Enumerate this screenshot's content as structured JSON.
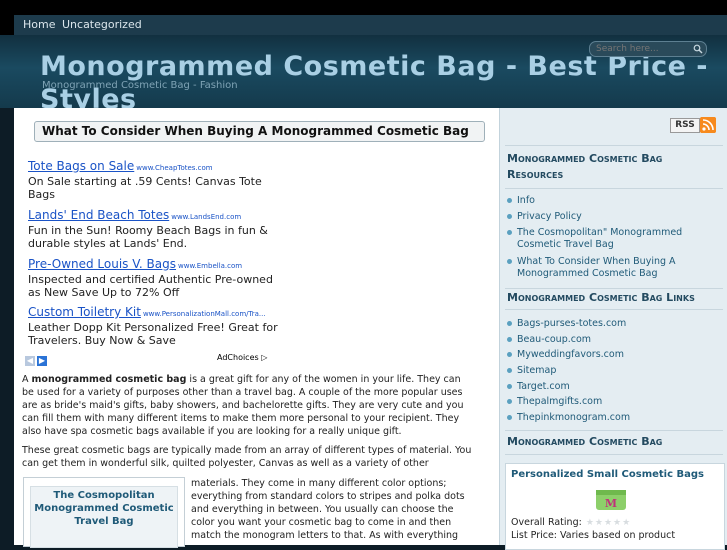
{
  "nav": {
    "items": [
      "Home",
      "Uncategorized"
    ]
  },
  "header": {
    "title_line1": "Monogrammed Cosmetic Bag - Best Price -",
    "title_line2": "Styles",
    "description": "Monogrammed Cosmetic Bag - Fashion"
  },
  "search": {
    "placeholder": "Search here..."
  },
  "post": {
    "title": "What To Consider When Buying A Monogrammed Cosmetic Bag"
  },
  "ads": [
    {
      "title": "Tote Bags on Sale",
      "url": "www.CheapTotes.com",
      "desc": "On Sale starting at .59 Cents! Canvas Tote Bags"
    },
    {
      "title": "Lands' End Beach Totes",
      "url": "www.LandsEnd.com",
      "desc": "Fun in the Sun! Roomy Beach Bags in fun & durable styles at Lands' End."
    },
    {
      "title": "Pre-Owned Louis V. Bags",
      "url": "www.Embella.com",
      "desc": "Inspected and certified Authentic Pre-owned as New Save Up to 72% Off"
    },
    {
      "title": "Custom Toiletry Kit",
      "url": "www.PersonalizationMall.com/Tra...",
      "desc": "Leather Dopp Kit Personalized Free! Great for Travelers. Buy Now & Save"
    }
  ],
  "adchoices": "AdChoices",
  "body": {
    "p1_pre": "A ",
    "p1_bold": "monogrammed cosmetic bag",
    "p1_post": " is a great gift for any of the women in your life.  They can be used for a variety of purposes other than a travel bag.  A couple of the more popular uses are as bride's maid's gifts, baby showers, and bachelorette gifts.  They are very cute and you can fill them with many different items to make them more personal to your recipient.  They also have spa cosmetic bags available if you are looking for a really unique gift.",
    "p2": "These great cosmetic bags are typically made from an array of different types of material.  You can get them in wonderful silk, quilted polyester, Canvas as well as a variety of other",
    "p3": "materials.  They come in many different color options; everything from standard colors to stripes and polka dots and everything in between. You usually can choose the color you want your cosmetic bag to come in and then match the monogram letters to that. As with everything"
  },
  "related": {
    "title": "The Cosmopolitan Monogrammed Cosmetic Travel Bag"
  },
  "sidebar": {
    "rss": "RSS",
    "resources_heading": "Monogrammed Cosmetic Bag Resources",
    "resources": [
      "Info",
      "Privacy Policy",
      "The Cosmopolitan\" Monogrammed Cosmetic Travel Bag",
      "What To Consider When Buying A Monogrammed Cosmetic Bag"
    ],
    "links_heading": "Monogrammed Cosmetic Bag Links",
    "links": [
      "Bags-purses-totes.com",
      "Beau-coup.com",
      "Myweddingfavors.com",
      "Sitemap",
      "Target.com",
      "Thepalmgifts.com",
      "Thepinkmonogram.com"
    ],
    "product_heading": "Monogrammed Cosmetic Bag",
    "product": {
      "title": "Personalized Small Cosmetic Bags",
      "monogram": "M",
      "rating_label": "Overall Rating:",
      "rating": 0,
      "price": "List Price: Varies based on product"
    }
  },
  "colors": {
    "link": "#1a53c6",
    "accent": "#1f5a78",
    "header_bg": "#1a4a60"
  }
}
